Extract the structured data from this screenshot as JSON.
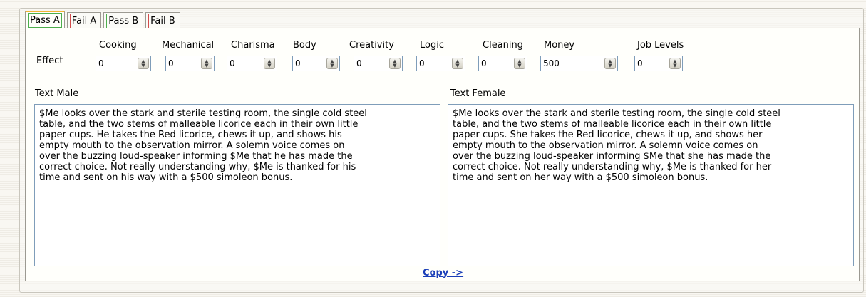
{
  "tabs": [
    {
      "label": "Pass A",
      "kind": "pass",
      "active": true
    },
    {
      "label": "Fail A",
      "kind": "fail",
      "active": false
    },
    {
      "label": "Pass B",
      "kind": "pass",
      "active": false
    },
    {
      "label": "Fail B",
      "kind": "fail",
      "active": false
    }
  ],
  "effect": {
    "label": "Effect",
    "fields": [
      {
        "name": "Cooking",
        "value": "0"
      },
      {
        "name": "Mechanical",
        "value": "0"
      },
      {
        "name": "Charisma",
        "value": "0"
      },
      {
        "name": "Body",
        "value": "0"
      },
      {
        "name": "Creativity",
        "value": "0"
      },
      {
        "name": "Logic",
        "value": "0"
      },
      {
        "name": "Cleaning",
        "value": "0"
      },
      {
        "name": "Money",
        "value": "500"
      },
      {
        "name": "Job Levels",
        "value": "0"
      }
    ]
  },
  "text_male": {
    "label": "Text Male",
    "lines": [
      "$Me looks over the stark and sterile testing room, the single cold steel",
      "table, and the two stems of malleable licorice each in their own little",
      "paper cups. He takes the Red licorice, chews it up, and shows his",
      "empty mouth to the observation mirror. A solemn voice comes on",
      "over the buzzing loud-speaker informing $Me that he has made the",
      "correct choice. Not really understanding why, $Me is thanked for his",
      "time and sent on his way with a $500 simoleon bonus."
    ]
  },
  "text_female": {
    "label": "Text Female",
    "lines": [
      "$Me looks over the stark and sterile testing room, the single cold steel",
      "table, and the two stems of malleable licorice each in their own little",
      "paper cups. She takes the Red licorice, chews it up, and shows her",
      "empty mouth to the observation mirror. A solemn voice comes on",
      "over the buzzing loud-speaker informing $Me that she has made the",
      "correct choice. Not really understanding why, $Me is thanked for her",
      "time and sent on her way with a $500 simoleon bonus."
    ]
  },
  "copy_link": "Copy ->",
  "colors": {
    "pass": "#4cae4c",
    "fail": "#d24b4b",
    "active_tab_top": "#f2b233",
    "link": "#1a3eb8"
  }
}
